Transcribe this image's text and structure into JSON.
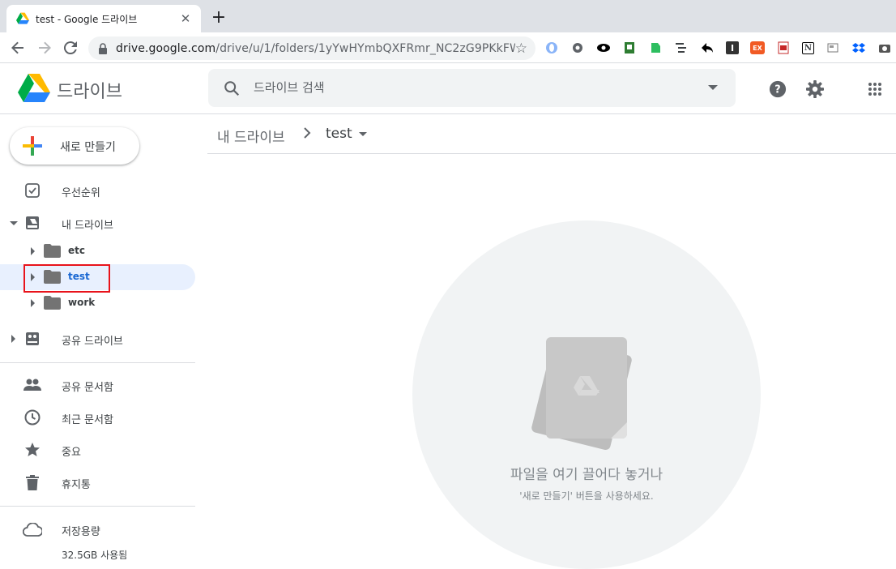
{
  "browser": {
    "tab_title": "test - Google 드라이브",
    "new_tab_symbol": "+",
    "close_symbol": "✕",
    "url_host": "drive.google.com",
    "url_path": "/drive/u/1/folders/1yYwHYmbQXFRmr_NC2zG9PKkFWqr...",
    "extensions": [
      "opera-icon",
      "gear-ext-icon",
      "eye-icon",
      "grammarly-icon",
      "evernote-icon",
      "outline-icon",
      "reply-icon",
      "instapaper-icon",
      "ex-icon",
      "pdf-icon",
      "notion-icon",
      "screen-icon",
      "dropbox-icon",
      "camera-icon"
    ],
    "ext_labels": {
      "instapaper": "I",
      "ex": "EX",
      "notion": "N"
    }
  },
  "header": {
    "product_name": "드라이브",
    "search_placeholder": "드라이브 검색"
  },
  "sidebar": {
    "new_button": "새로 만들기",
    "priority": "우선순위",
    "my_drive": "내 드라이브",
    "folders": [
      {
        "label": "etc"
      },
      {
        "label": "test"
      },
      {
        "label": "work"
      }
    ],
    "shared_drives": "공유 드라이브",
    "shared_with_me": "공유 문서함",
    "recent": "최근 문서함",
    "starred": "중요",
    "trash": "휴지통",
    "storage": "저장용량",
    "storage_used": "32.5GB 사용됨"
  },
  "main": {
    "breadcrumb_root": "내 드라이브",
    "breadcrumb_current": "test",
    "empty_title": "파일을 여기 끌어다 놓거나",
    "empty_subtitle": "'새로 만들기' 버튼을 사용하세요."
  },
  "colors": {
    "selected_bg": "#e8f0fe",
    "selected_text": "#1967d2",
    "highlight": "#e8131b"
  }
}
